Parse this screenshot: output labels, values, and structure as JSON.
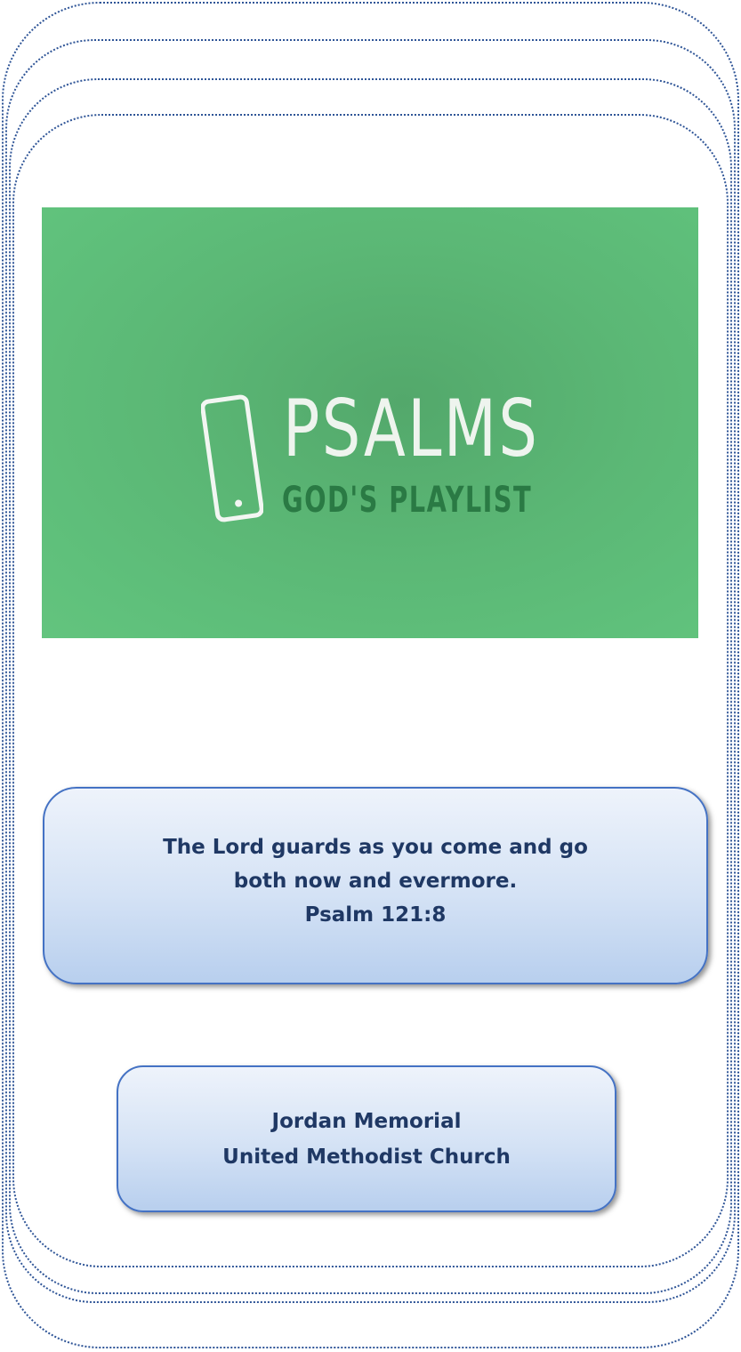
{
  "cover": {
    "title": "PSALMS",
    "subtitle": "GOD'S PLAYLIST",
    "icon": "phone-icon",
    "background_color": "#5fbf7a"
  },
  "verse": {
    "line1": "The Lord guards as you come and go",
    "line2": "both now and evermore.",
    "reference": "Psalm 121:8"
  },
  "church": {
    "line1": "Jordan Memorial",
    "line2": "United Methodist Church"
  },
  "colors": {
    "border": "#2f5597",
    "box_text": "#1f3864",
    "box_fill": "#d4e2f5"
  }
}
